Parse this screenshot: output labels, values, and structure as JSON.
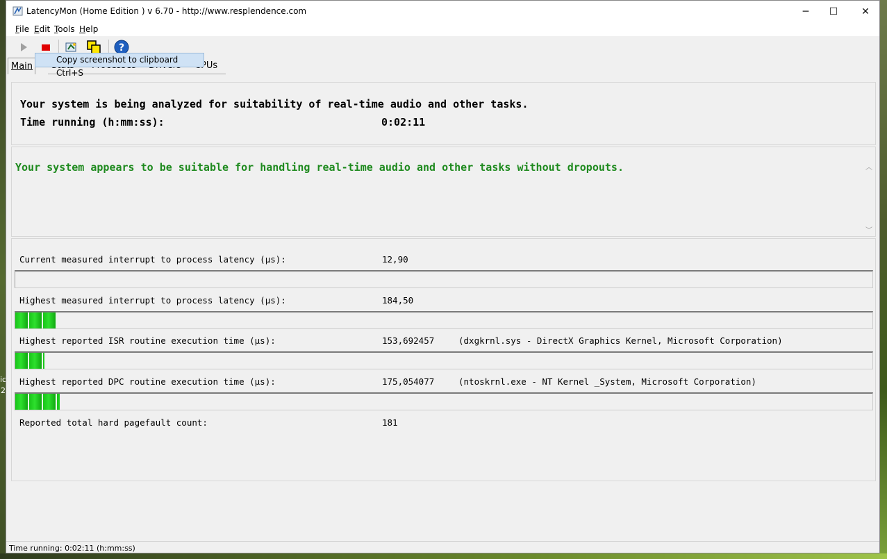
{
  "desktop": {
    "left_glyphs": [
      "ic",
      "2"
    ]
  },
  "window": {
    "title": "LatencyMon  (Home Edition )  v 6.70 - http://www.resplendence.com",
    "controls": {
      "minimize": "─",
      "maximize": "☐",
      "close": "✕"
    }
  },
  "menu": {
    "items": [
      {
        "underline": "F",
        "rest": "ile"
      },
      {
        "underline": "E",
        "rest": "dit"
      },
      {
        "underline": "T",
        "rest": "ools"
      },
      {
        "underline": "H",
        "rest": "elp"
      }
    ]
  },
  "toolbar": {
    "tooltip": "Copy screenshot to clipboard Ctrl+S",
    "icons": [
      "play-icon",
      "stop-icon",
      "screenshot-icon",
      "copy-icon",
      "help-icon"
    ]
  },
  "tabs": {
    "items": [
      "Main",
      "Stats",
      "Processes",
      "Drivers",
      "CPUs"
    ],
    "active": "Main"
  },
  "main": {
    "analysis_line": "Your system is being analyzed for suitability of real-time audio and other tasks.",
    "time_label": "Time running (h:mm:ss):",
    "time_value": "0:02:11",
    "verdict": "Your system appears to be suitable for handling real-time audio and other tasks without dropouts.",
    "verdict_color": "#1e8a1e",
    "metrics": [
      {
        "label": "Current measured interrupt to process latency (µs):",
        "value": "12,90",
        "detail": "",
        "bar_fraction": 0.0
      },
      {
        "label": "Highest measured interrupt to process latency (µs):",
        "value": "184,50",
        "detail": "",
        "bar_fraction": 0.049
      },
      {
        "label": "Highest reported ISR routine execution time (µs):",
        "value": "153,692457",
        "detail": "(dxgkrnl.sys - DirectX Graphics Kernel, Microsoft Corporation)",
        "bar_fraction": 0.034
      },
      {
        "label": "Highest reported DPC routine execution time (µs):",
        "value": "175,054077",
        "detail": "(ntoskrnl.exe - NT Kernel _System, Microsoft Corporation)",
        "bar_fraction": 0.052
      }
    ],
    "pagefault_label": "Reported total hard pagefault count:",
    "pagefault_value": "181"
  },
  "status": {
    "text": "Time running: 0:02:11  (h:mm:ss)"
  },
  "colors": {
    "bar_green": "#22cc22",
    "help_blue": "#1f5fbf",
    "stop_red": "#e00000"
  }
}
